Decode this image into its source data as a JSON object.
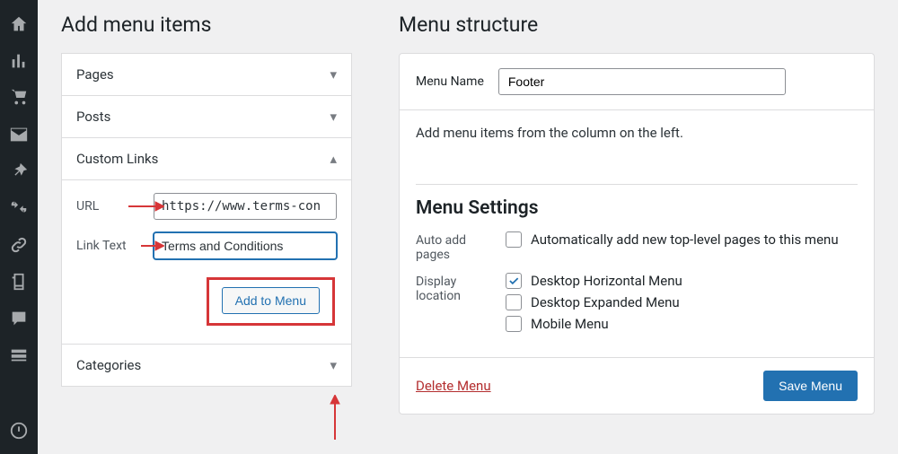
{
  "headings": {
    "add_items": "Add menu items",
    "structure": "Menu structure",
    "settings": "Menu Settings"
  },
  "accordion": {
    "pages": "Pages",
    "posts": "Posts",
    "custom_links": "Custom Links",
    "categories": "Categories"
  },
  "custom_links": {
    "url_label": "URL",
    "url_value": "https://www.terms-con",
    "link_text_label": "Link Text",
    "link_text_value": "Terms and Conditions",
    "add_button": "Add to Menu"
  },
  "menu_name": {
    "label": "Menu Name",
    "value": "Footer"
  },
  "hint": "Add menu items from the column on the left.",
  "settings": {
    "auto_add_label": "Auto add pages",
    "auto_add_option": "Automatically add new top-level pages to this menu",
    "display_loc_label": "Display location",
    "loc1": "Desktop Horizontal Menu",
    "loc2": "Desktop Expanded Menu",
    "loc3": "Mobile Menu"
  },
  "footer": {
    "delete": "Delete Menu",
    "save": "Save Menu"
  }
}
